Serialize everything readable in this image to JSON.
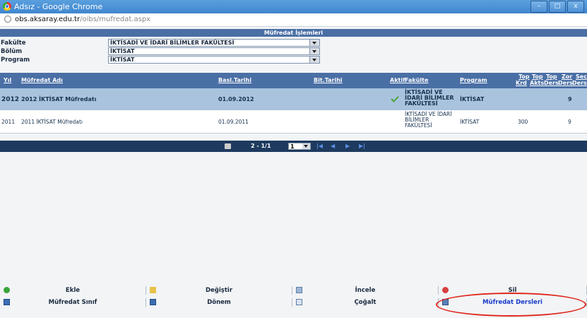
{
  "window": {
    "title": "Adsız - Google Chrome",
    "controls": [
      "–",
      "□",
      "x"
    ]
  },
  "address": {
    "domain": "obs.aksaray.edu.tr",
    "path": "/oibs/mufredat.aspx"
  },
  "panel": {
    "title": "Müfredat İşlemleri"
  },
  "filters": [
    {
      "label": "Fakülte",
      "value": "İKTİSADİ VE İDARİ BİLİMLER FAKÜLTESİ"
    },
    {
      "label": "Bölüm",
      "value": "İKTİSAT"
    },
    {
      "label": "Program",
      "value": "İKTİSAT"
    }
  ],
  "grid": {
    "headers": {
      "yil": "Yıl",
      "mufredat_adi": "Müfredat Adı",
      "basl_tarihi": "Basl.Tarihi",
      "bit_tarihi": "Bit.Tarihi",
      "aktif": "Aktif",
      "fakulte": "Fakülte",
      "program": "Program",
      "top_krd_1": "Top",
      "top_krd_2": "Krd",
      "top_akts_1": "Top",
      "top_akts_2": "Akts",
      "top_ders_1": "Top",
      "top_ders_2": "Ders",
      "zor_ders_1": "Zor",
      "zor_ders_2": "Ders",
      "sec_ders_1": "Sec",
      "sec_ders_2": "Ders"
    },
    "rows": [
      {
        "yil": "2012",
        "mufredat_adi": "2012 İKTİSAT Müfredatı",
        "basl_tarihi": "01.09.2012",
        "bit_tarihi": "",
        "aktif_icon": "checkmark-icon",
        "fakulte_lines": [
          "İKTİSADİ VE",
          "İDARİ BİLİMLER",
          "FAKÜLTESİ"
        ],
        "program": "İKTİSAT",
        "top_akts": "",
        "top_ders": "9"
      },
      {
        "yil": "2011",
        "mufredat_adi": "2011 İKTİSAT Müfredatı",
        "basl_tarihi": "01.09.2011",
        "bit_tarihi": "",
        "fakulte_lines": [
          "İKTİSADİ VE İDARİ",
          "BİLİMLER",
          "FAKÜLTESİ"
        ],
        "program": "İKTİSAT",
        "top_akts": "300",
        "top_ders": "9"
      }
    ]
  },
  "pager": {
    "info": "2 - 1/1",
    "page": "1",
    "nav": [
      "|◀",
      "◀",
      "▶",
      "▶|"
    ]
  },
  "toolbar": {
    "row1": [
      {
        "label": "Ekle",
        "icon": "add-icon"
      },
      {
        "label": "Değiştir",
        "icon": "edit-icon"
      },
      {
        "label": "İncele",
        "icon": "view-icon"
      },
      {
        "label": "Sil",
        "icon": "delete-icon"
      }
    ],
    "row2": [
      {
        "label": "Müfredat Sınıf",
        "icon": "book-icon"
      },
      {
        "label": "Dönem",
        "icon": "book-icon"
      },
      {
        "label": "Çoğalt",
        "icon": "copy-icon"
      },
      {
        "label": "Müfredat Dersleri",
        "icon": "monitor-icon"
      }
    ]
  },
  "colors": {
    "header_bg": "#4a6fa5",
    "selected_row_bg": "#a9c3de",
    "pager_bg": "#1e3a5f",
    "highlight": "#e0261c"
  }
}
